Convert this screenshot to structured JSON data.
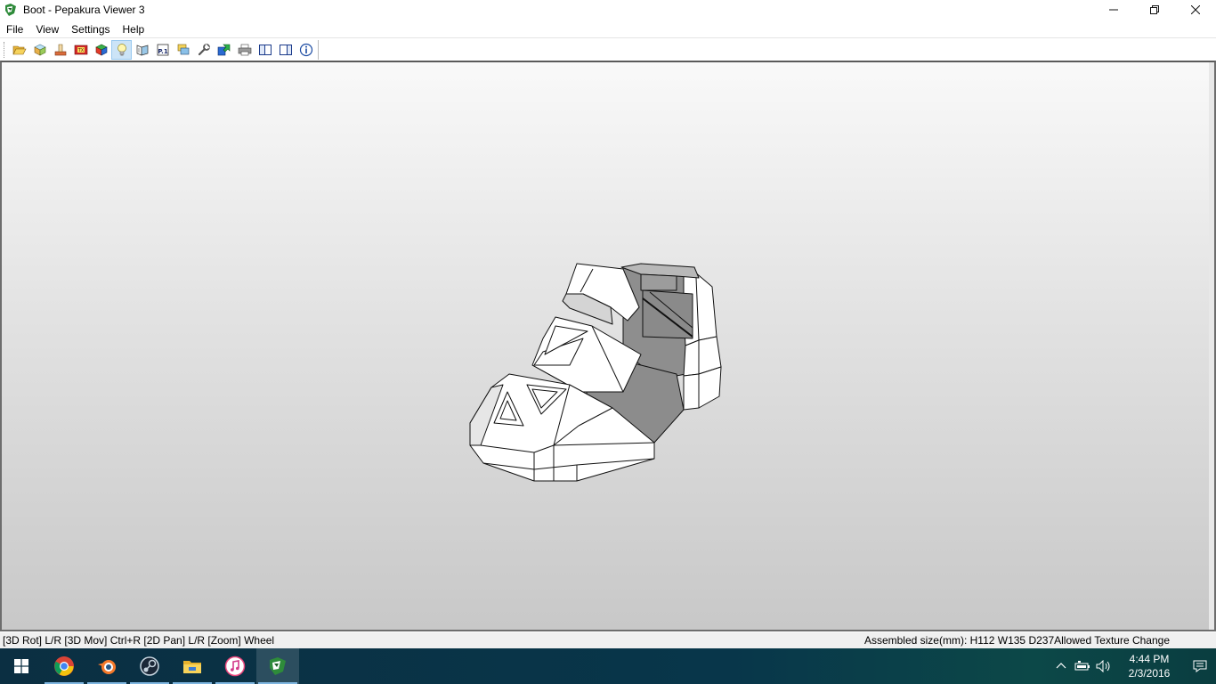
{
  "window": {
    "title": "Boot - Pepakura Viewer 3"
  },
  "menu": {
    "items": [
      "File",
      "View",
      "Settings",
      "Help"
    ]
  },
  "toolbar": {
    "buttons": [
      {
        "icon": "open-folder-icon"
      },
      {
        "icon": "model-box-icon"
      },
      {
        "icon": "paper-cut-icon"
      },
      {
        "icon": "texture-icon"
      },
      {
        "icon": "colored-cube-icon"
      },
      {
        "icon": "light-bulb-icon",
        "active": true
      },
      {
        "icon": "unfold-icon"
      },
      {
        "icon": "page-number-icon",
        "label": "P.1"
      },
      {
        "icon": "layers-icon"
      },
      {
        "icon": "wrench-icon"
      },
      {
        "icon": "green-arrow-icon"
      },
      {
        "icon": "printer-icon"
      },
      {
        "icon": "single-pane-icon"
      },
      {
        "icon": "split-pane-icon"
      },
      {
        "icon": "info-icon"
      }
    ]
  },
  "status": {
    "left": "[3D Rot] L/R [3D Mov] Ctrl+R [2D Pan] L/R [Zoom] Wheel",
    "right": "Assembled size(mm): H112 W135 D237Allowed Texture Change"
  },
  "taskbar": {
    "apps": [
      {
        "icon": "windows-start-icon"
      },
      {
        "icon": "chrome-icon",
        "running": true
      },
      {
        "icon": "blender-icon",
        "running": true
      },
      {
        "icon": "steam-icon",
        "running": true
      },
      {
        "icon": "file-explorer-icon",
        "running": true
      },
      {
        "icon": "itunes-icon",
        "running": true
      },
      {
        "icon": "pepakura-icon",
        "running": true,
        "active": true
      }
    ],
    "clock_time": "4:44 PM",
    "clock_date": "2/3/2016"
  },
  "colors": {
    "viewport_top": "#f9f9f9",
    "viewport_bottom": "#c8c8c8",
    "face_light": "#ffffff",
    "face_shadow": "#8e8e8e",
    "edge": "#111111"
  }
}
